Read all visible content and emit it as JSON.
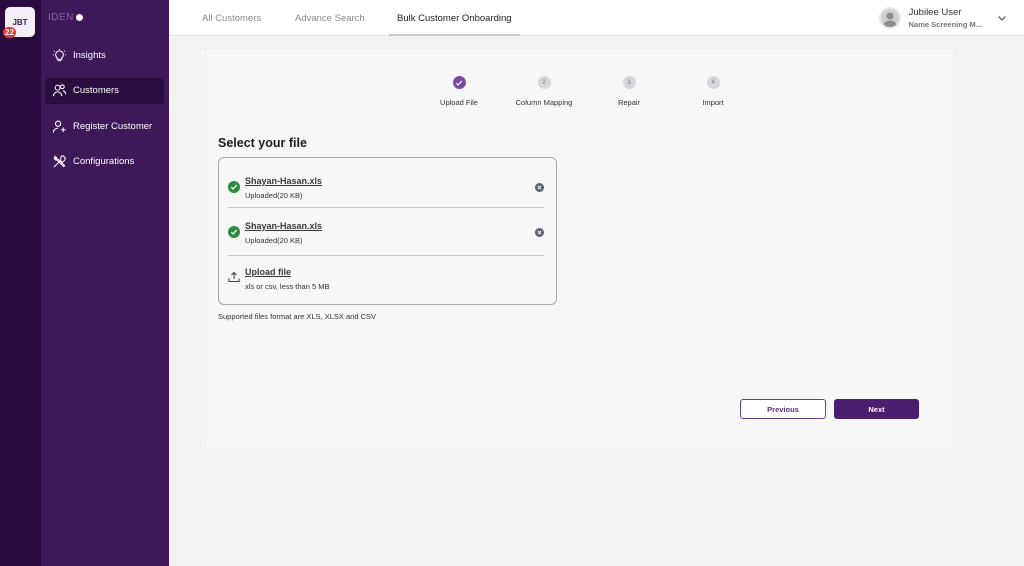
{
  "rail": {
    "app_tile": "JBT",
    "badge": "22"
  },
  "sidebar": {
    "brand": "IDEN",
    "items": [
      {
        "label": "Insights",
        "icon": "lightbulb-icon",
        "active": false
      },
      {
        "label": "Customers",
        "icon": "users-icon",
        "active": true
      },
      {
        "label": "Register Customer",
        "icon": "user-add-icon",
        "active": false
      },
      {
        "label": "Configurations",
        "icon": "tools-icon",
        "active": false
      }
    ]
  },
  "header": {
    "tabs": [
      {
        "label": "All Customers",
        "active": false
      },
      {
        "label": "Advance Search",
        "active": false
      },
      {
        "label": "Bulk Customer Onboarding",
        "active": true
      }
    ],
    "user": {
      "name": "Jubilee User",
      "role": "Name Screening M..."
    }
  },
  "stepper": {
    "steps": [
      {
        "number": "1",
        "label": "Upload File",
        "done": true
      },
      {
        "number": "2",
        "label": "Column Mapping",
        "done": false
      },
      {
        "number": "3",
        "label": "Repair",
        "done": false
      },
      {
        "number": "4",
        "label": "Import",
        "done": false
      }
    ]
  },
  "upload": {
    "title": "Select your file",
    "files": [
      {
        "name": "Shayan-Hasan.xls",
        "status": "Uploaded(20 KB)"
      },
      {
        "name": "Shayan-Hasan.xls",
        "status": "Uploaded(20 KB)"
      }
    ],
    "upload_label": "Upload file",
    "upload_hint": "xls or csv, less than 5 MB",
    "supported": "Supported files format are XLS, XLSX and CSV"
  },
  "actions": {
    "previous": "Previous",
    "next": "Next"
  },
  "colors": {
    "sidebar": "#3e1858",
    "rail": "#2a0a3f",
    "primary": "#4b1d6e",
    "success": "#2e8b3d"
  }
}
